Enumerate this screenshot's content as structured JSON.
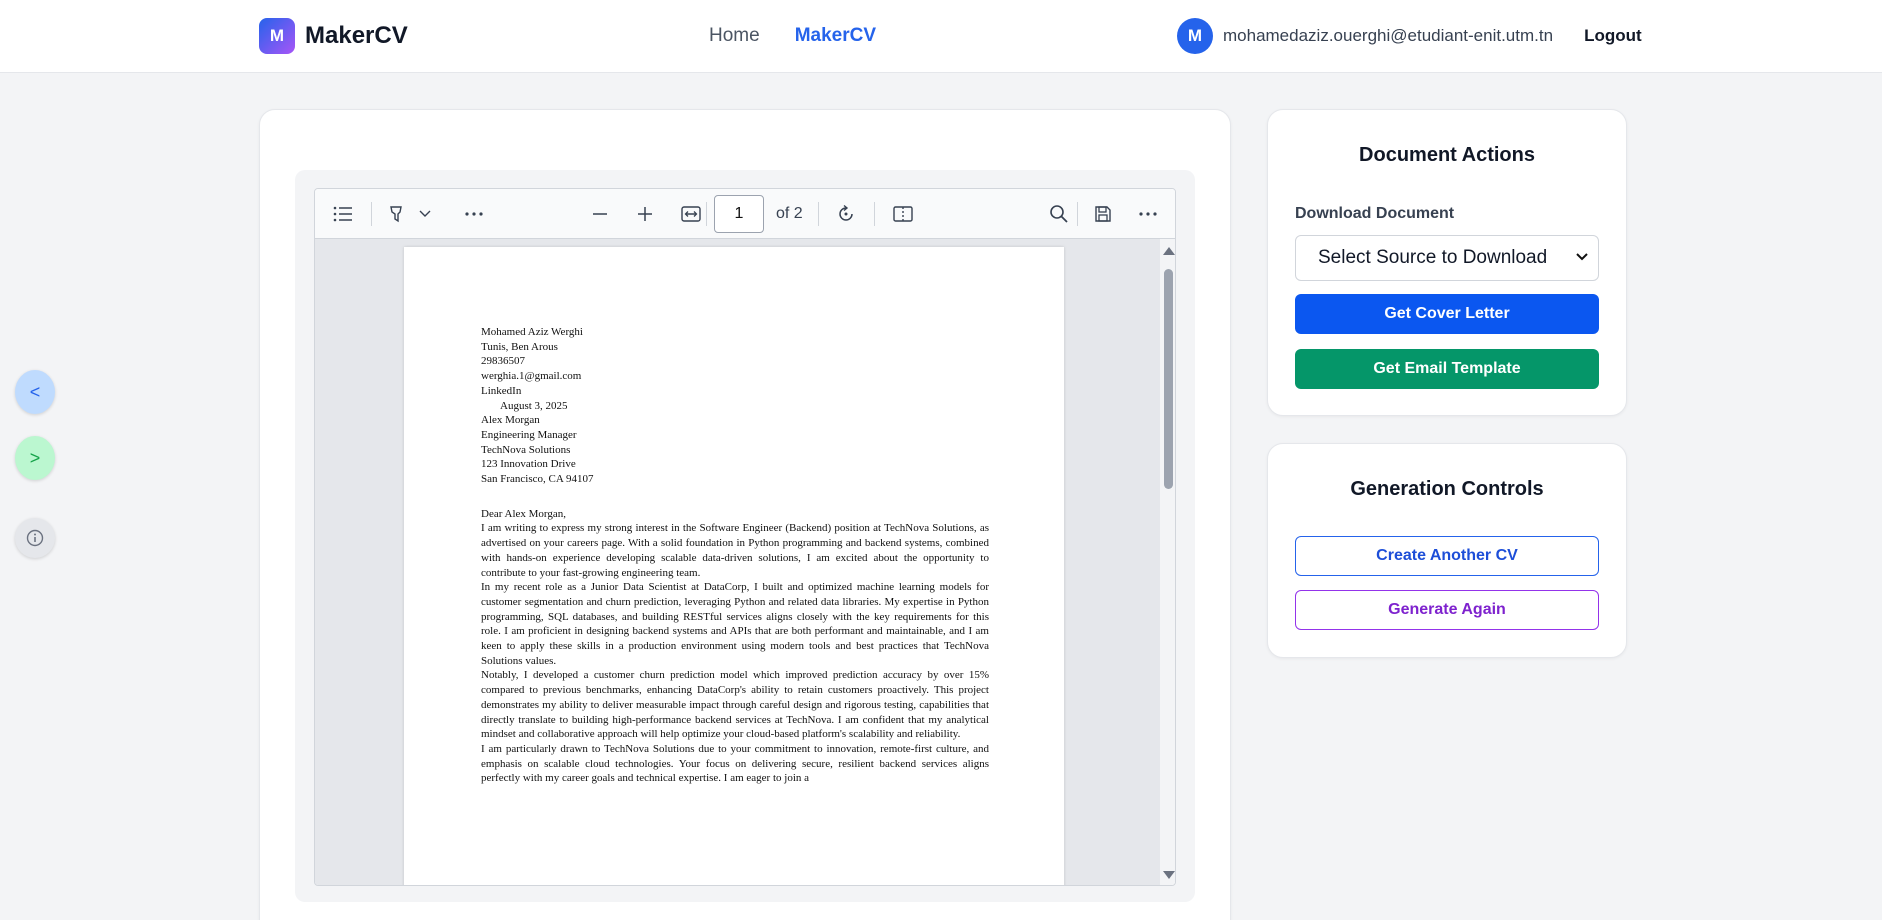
{
  "header": {
    "logo_letter": "M",
    "brand": "MakerCV",
    "nav": {
      "home": "Home",
      "makercv": "MakerCV"
    },
    "user": {
      "avatar_letter": "M",
      "email": "mohamedaziz.ouerghi@etudiant-enit.utm.tn",
      "logout": "Logout"
    }
  },
  "side": {
    "prev": "<",
    "next": ">",
    "info": "ⓘ"
  },
  "viewer": {
    "page_number": "1",
    "page_total": "of 2",
    "letter": {
      "sender": [
        "Mohamed Aziz Werghi",
        "Tunis, Ben Arous",
        "29836507",
        "werghia.1@gmail.com",
        "LinkedIn"
      ],
      "date": "August 3, 2025",
      "recipient": [
        "Alex Morgan",
        "Engineering Manager",
        "TechNova Solutions",
        "123 Innovation Drive",
        "San Francisco, CA 94107"
      ],
      "salutation": "Dear Alex Morgan,",
      "paragraphs": [
        "I am writing to express my strong interest in the Software Engineer (Backend) position at TechNova Solutions, as advertised on your careers page. With a solid foundation in Python programming and backend systems, combined with hands-on experience developing scalable data-driven solutions, I am excited about the opportunity to contribute to your fast-growing engineering team.",
        "In my recent role as a Junior Data Scientist at DataCorp, I built and optimized machine learning models for customer segmentation and churn prediction, leveraging Python and related data libraries. My expertise in Python programming, SQL databases, and building RESTful services aligns closely with the key requirements for this role. I am proficient in designing backend systems and APIs that are both performant and maintainable, and I am keen to apply these skills in a production environment using modern tools and best practices that TechNova Solutions values.",
        "Notably, I developed a customer churn prediction model which improved prediction accuracy by over 15% compared to previous benchmarks, enhancing DataCorp's ability to retain customers proactively. This project demonstrates my ability to deliver measurable impact through careful design and rigorous testing, capabilities that directly translate to building high-performance backend services at TechNova. I am confident that my analytical mindset and collaborative approach will help optimize your cloud-based platform's scalability and reliability.",
        "I am particularly drawn to TechNova Solutions due to your commitment to innovation, remote-first culture, and emphasis on scalable cloud technologies. Your focus on delivering secure, resilient backend services aligns perfectly with my career goals and technical expertise. I am eager to join a"
      ]
    }
  },
  "actions": {
    "title": "Document Actions",
    "download_label": "Download Document",
    "select_value": "Select Source to Download",
    "cover_letter_btn": "Get Cover Letter",
    "email_template_btn": "Get Email Template"
  },
  "generation": {
    "title": "Generation Controls",
    "create_btn": "Create Another CV",
    "regenerate_btn": "Generate Again"
  },
  "colors": {
    "primary": "#2563eb",
    "success": "#059669",
    "purple": "#9333ea"
  }
}
